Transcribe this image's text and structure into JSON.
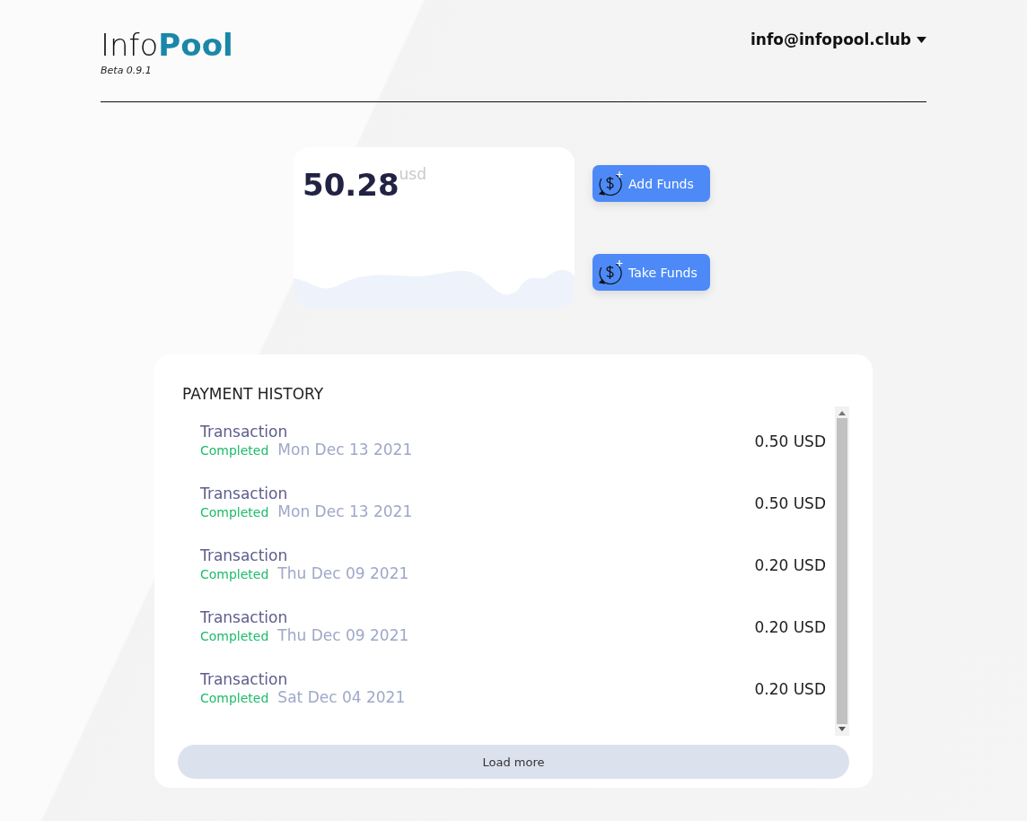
{
  "header": {
    "logo_light": "Info",
    "logo_bold": "Pool",
    "version": "Beta 0.9.1",
    "account": "info@infopool.club"
  },
  "balance": {
    "amount": "50.28",
    "currency": "usd"
  },
  "actions": [
    {
      "label": "Add Funds"
    },
    {
      "label": "Take Funds"
    }
  ],
  "payment_history": {
    "title": "PAYMENT HISTORY",
    "rows": [
      {
        "title": "Transaction",
        "status": "Completed",
        "date": "Mon Dec 13 2021",
        "amount": "0.50 USD"
      },
      {
        "title": "Transaction",
        "status": "Completed",
        "date": "Mon Dec 13 2021",
        "amount": "0.50 USD"
      },
      {
        "title": "Transaction",
        "status": "Completed",
        "date": "Thu Dec 09 2021",
        "amount": "0.20 USD"
      },
      {
        "title": "Transaction",
        "status": "Completed",
        "date": "Thu Dec 09 2021",
        "amount": "0.20 USD"
      },
      {
        "title": "Transaction",
        "status": "Completed",
        "date": "Sat Dec 04 2021",
        "amount": "0.20 USD"
      }
    ],
    "load_more": "Load more"
  }
}
